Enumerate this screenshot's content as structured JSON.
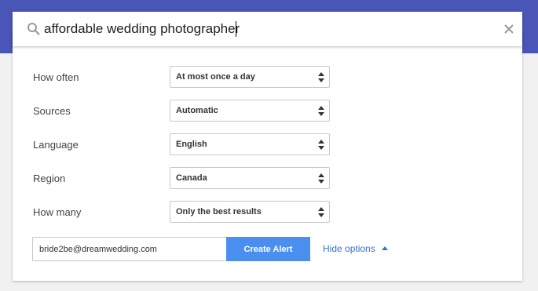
{
  "search": {
    "value": "affordable wedding photographer",
    "icon": "search-icon",
    "clear_icon": "close-icon"
  },
  "options": [
    {
      "label": "How often",
      "value": "At most once a day"
    },
    {
      "label": "Sources",
      "value": "Automatic"
    },
    {
      "label": "Language",
      "value": "English"
    },
    {
      "label": "Region",
      "value": "Canada"
    },
    {
      "label": "How many",
      "value": "Only the best results"
    }
  ],
  "footer": {
    "email": "bride2be@dreamwedding.com",
    "create_label": "Create Alert",
    "hide_options_label": "Hide options"
  },
  "colors": {
    "header": "#4a55b8",
    "primary_button": "#4a8ff0",
    "link": "#3b6fd8"
  }
}
